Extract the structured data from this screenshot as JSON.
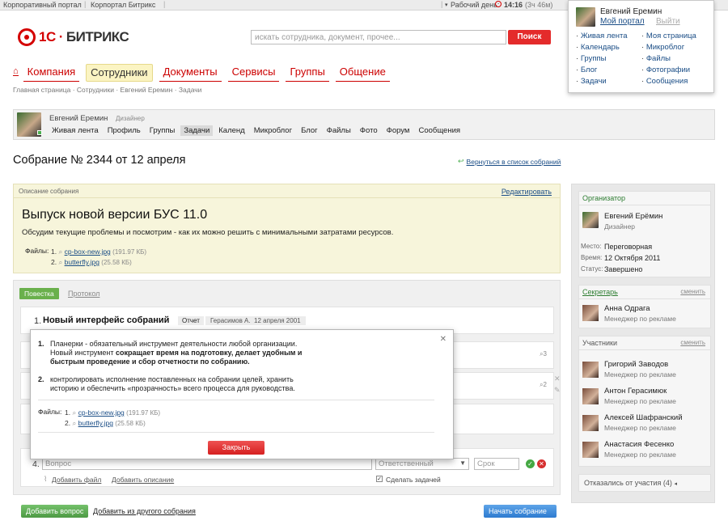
{
  "topbar": {
    "link1": "Корпоративный портал",
    "link2": "Корпортал Битрикс",
    "workday_label": "Рабочий день:",
    "time": "14:16",
    "elapsed": "(3ч 46м)"
  },
  "header": {
    "logo_prefix": "1С",
    "logo_text": "БИТРИКС",
    "search_placeholder": "искать сотрудника, документ, прочее...",
    "search_button": "Поиск"
  },
  "user_popup": {
    "name": "Евгений Еремин",
    "my_portal": "Мой портал",
    "logout": "Выйти",
    "links_left": [
      "Живая лента",
      "Календарь",
      "Группы",
      "Блог",
      "Задачи"
    ],
    "links_right": [
      "Моя страница",
      "Микроблог",
      "Файлы",
      "Фотографии",
      "Сообщения"
    ]
  },
  "nav": {
    "items": [
      "Компания",
      "Сотрудники",
      "Документы",
      "Сервисы",
      "Группы",
      "Общение"
    ],
    "active_index": 1
  },
  "breadcrumbs": [
    "Главная страница",
    "Сотрудники",
    "Евгений Еремин",
    "Задачи"
  ],
  "profile": {
    "name": "Евгений Еремин",
    "position": "Дизайнер",
    "tabs": [
      "Живая лента",
      "Профиль",
      "Группы",
      "Задачи",
      "Календ",
      "Микроблог",
      "Блог",
      "Файлы",
      "Фото",
      "Форум",
      "Сообщения"
    ],
    "selected_tab": 3
  },
  "page": {
    "title": "Собрание № 2344 от 12 апреля",
    "back_link": "Вернуться в список собраний"
  },
  "description": {
    "label": "Описание собрания",
    "edit_link": "Редактировать",
    "heading": "Выпуск новой версии БУС 11.0",
    "text": "Обсудим текущие проблемы и посмотрим - как их можно решить с минимальными затратами ресурсов.",
    "files_label": "Файлы:",
    "files": [
      {
        "num": "1.",
        "name": "cp-box-new.jpg",
        "size": "(191.97 КБ)"
      },
      {
        "num": "2.",
        "name": "butterfly.jpg",
        "size": "(25.58 КБ)"
      }
    ]
  },
  "agenda": {
    "tab_active": "Повестка",
    "tab_inactive": "Протокол",
    "item1": {
      "num": "1.",
      "title": "Новый интерфейс собраний",
      "report_label": "Отчет",
      "author": "Герасимов А.",
      "date": "12 апреля 2001"
    },
    "item2_comments": "3",
    "item3_comments": "2",
    "new_item": {
      "num": "4.",
      "question_placeholder": "Вопрос",
      "responsible_placeholder": "Ответственный",
      "deadline_placeholder": "Срок",
      "add_file": "Добавить файл",
      "add_description": "Добавить описание",
      "make_task": "Сделать задачей"
    },
    "add_question_button": "Добавить вопрос",
    "add_from_other": "Добавить из другого собрания",
    "start_button": "Начать собрание"
  },
  "popup": {
    "p1_num": "1.",
    "p1_line1": "Планерки - обязательный инструмент деятельности любой организации.",
    "p1_line2a": "Новый инструмент ",
    "p1_line2b": "сокращает время на подготовку, делает удобным и",
    "p1_line3": "быстрым проведение и сбор отчетности по собранию.",
    "p2_num": "2.",
    "p2_line1": "контролировать исполнение поставленных на собрании целей, хранить",
    "p2_line2": "историю и обеспечить «прозрачность» всего процесса для руководства.",
    "files_label": "Файлы:",
    "files": [
      {
        "num": "1.",
        "name": "cp-box-new.jpg",
        "size": "(191.97 КБ)"
      },
      {
        "num": "2.",
        "name": "butterfly.jpg",
        "size": "(25.58 КБ)"
      }
    ],
    "close_button": "Закрыть"
  },
  "sidebar": {
    "organizer_label": "Организатор",
    "organizer_name": "Евгений Ерёмин",
    "organizer_role": "Дизайнер",
    "place_label": "Место:",
    "place": "Переговорная",
    "time_label": "Время:",
    "time": "12 Октября 2011",
    "status_label": "Статус:",
    "status": "Завершено",
    "secretary_label": "Секретарь",
    "change": "сменить",
    "secretary_name": "Анна Одрага",
    "secretary_role": "Менеджер по рекламе",
    "participants_label": "Участники",
    "participants": [
      {
        "name": "Григорий Заводов",
        "role": "Менеджер по рекламе"
      },
      {
        "name": "Антон Герасимюк",
        "role": "Менеджер по рекламе"
      },
      {
        "name": "Алексей Шафранский",
        "role": "Менеджер по рекламе"
      },
      {
        "name": "Анастасия Фесенко",
        "role": "Менеджер по рекламе"
      }
    ],
    "declined": "Отказались от участия (4)"
  },
  "colors": {
    "brand_red": "#d40000",
    "link_blue": "#1a4d86",
    "green": "#6ab04c",
    "desc_bg": "#f7f5db"
  }
}
